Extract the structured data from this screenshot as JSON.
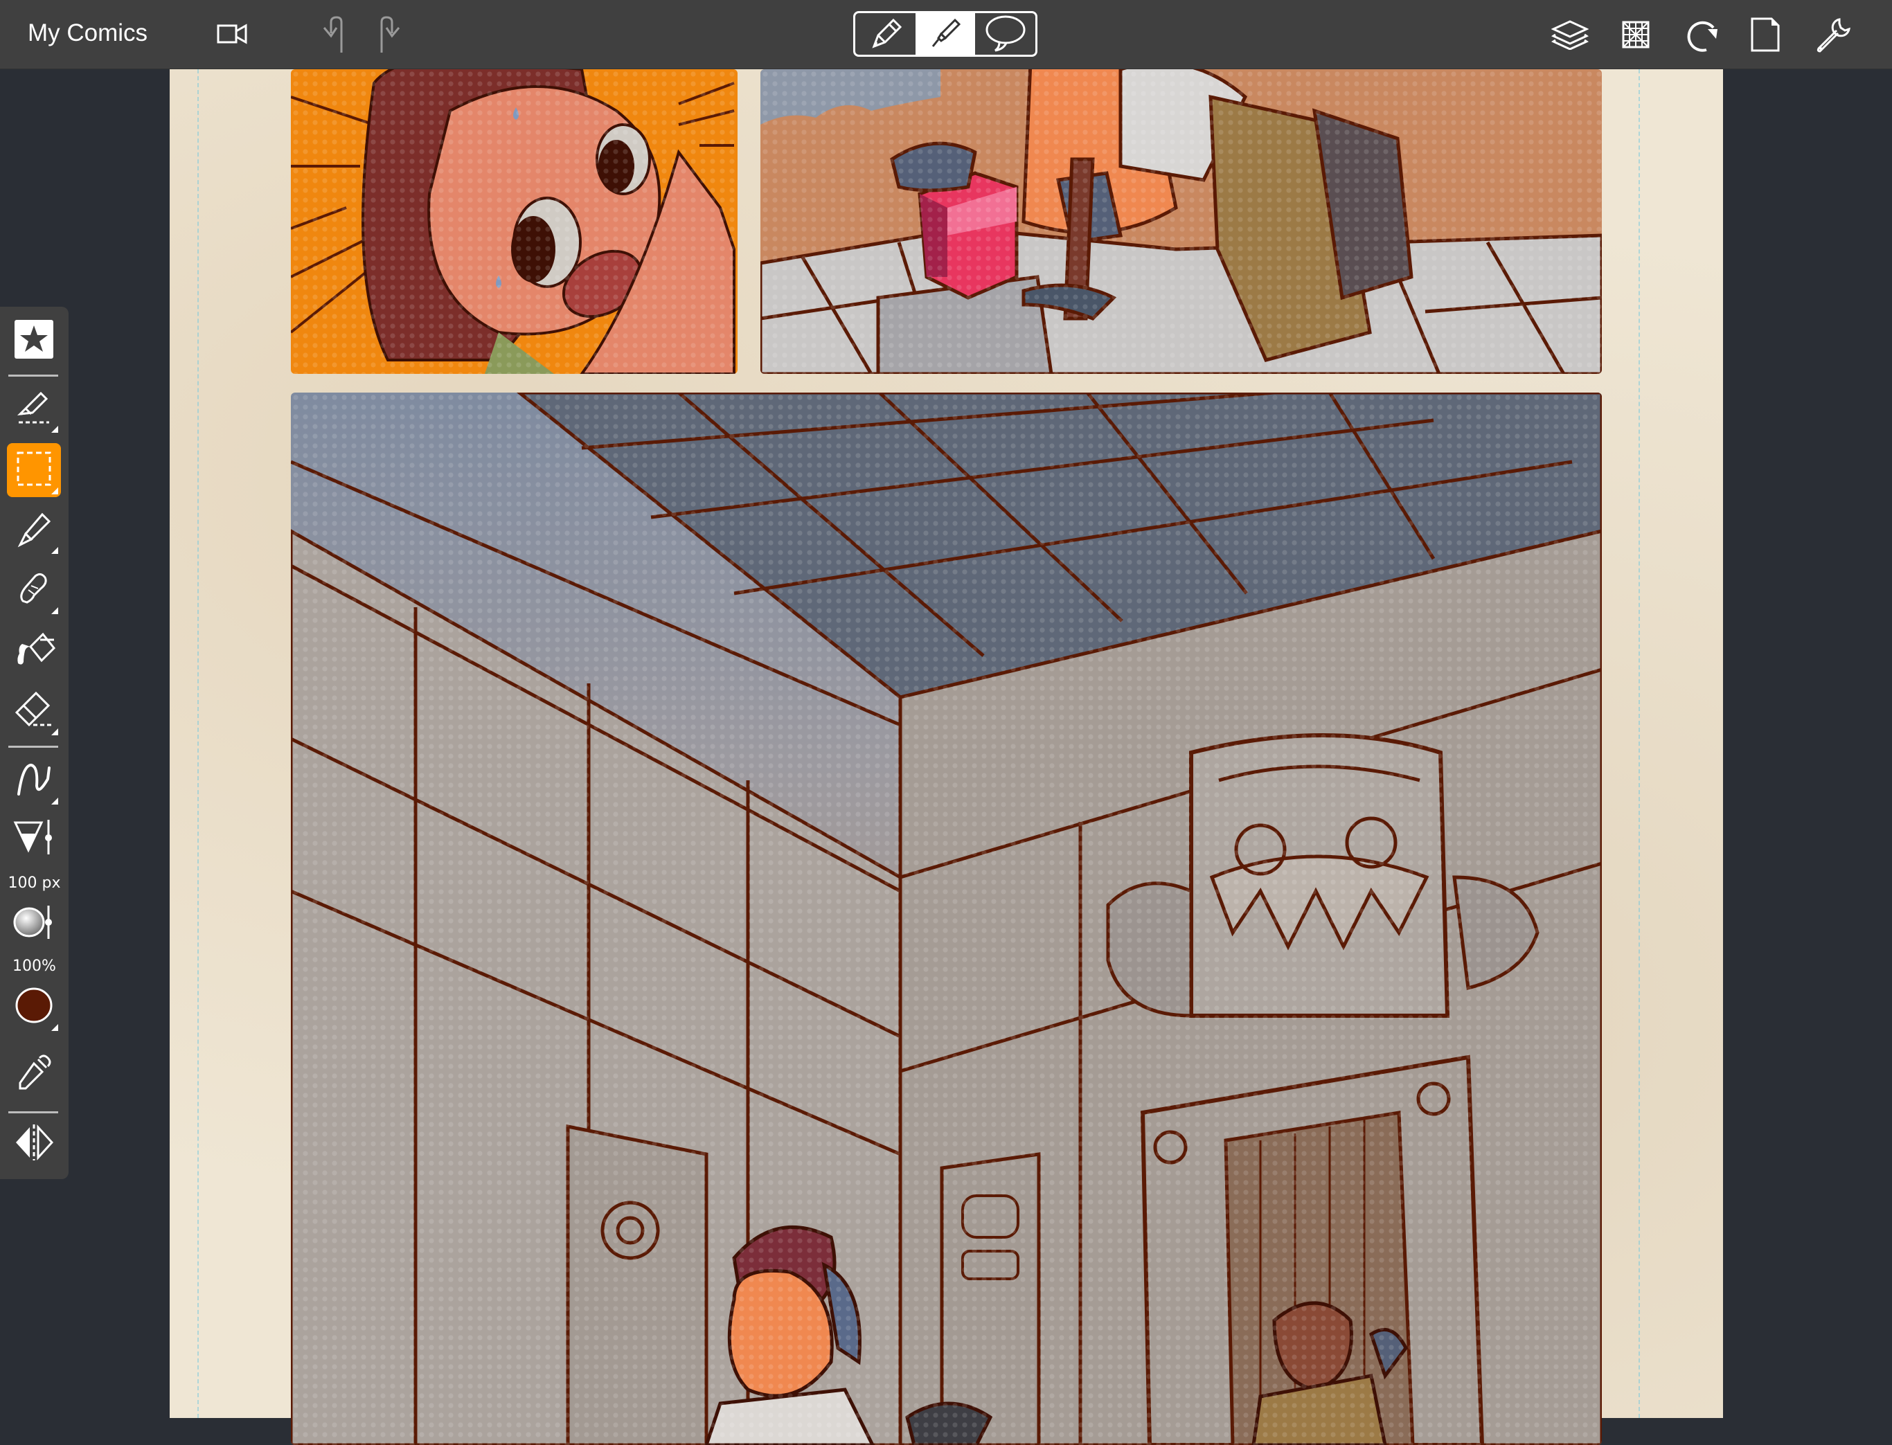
{
  "app": {
    "title": "My Comics"
  },
  "top_bar": {
    "left_icons": [
      {
        "name": "record-video-icon"
      },
      {
        "name": "undo-icon"
      },
      {
        "name": "redo-icon"
      }
    ],
    "mode_switcher": {
      "options": [
        {
          "name": "pencil-mode",
          "icon": "pencil-icon",
          "active": false
        },
        {
          "name": "ink-pen-mode",
          "icon": "ink-pen-icon",
          "active": true
        },
        {
          "name": "speech-bubble-mode",
          "icon": "speech-bubble-icon",
          "active": false
        }
      ]
    },
    "right_icons": [
      {
        "name": "layers-icon"
      },
      {
        "name": "perspective-guide-icon"
      },
      {
        "name": "rotate-canvas-icon"
      },
      {
        "name": "page-icon"
      },
      {
        "name": "settings-wrench-icon"
      }
    ]
  },
  "toolbar": {
    "tools": [
      {
        "name": "favorites",
        "icon": "star-icon",
        "active": false
      },
      {
        "name": "ruler-pen",
        "icon": "ruler-pen-icon",
        "active": false
      },
      {
        "name": "rectangle-selection",
        "icon": "selection-rectangle-icon",
        "active": true
      },
      {
        "name": "pen",
        "icon": "pen-icon",
        "active": false
      },
      {
        "name": "smudge",
        "icon": "smudge-finger-icon",
        "active": false
      },
      {
        "name": "paint-bucket",
        "icon": "paint-bucket-icon",
        "active": false
      },
      {
        "name": "eraser",
        "icon": "eraser-icon",
        "active": false
      },
      {
        "name": "stroke-style",
        "icon": "stroke-curve-icon",
        "active": false
      },
      {
        "name": "brush-size",
        "icon": "brush-size-icon",
        "active": false
      },
      {
        "name": "opacity",
        "icon": "opacity-icon",
        "active": false
      },
      {
        "name": "color",
        "icon": "color-swatch-icon",
        "active": false
      },
      {
        "name": "eyedropper",
        "icon": "eyedropper-icon",
        "active": false
      },
      {
        "name": "flip",
        "icon": "flip-horizontal-icon",
        "active": false
      }
    ],
    "brush_size_label": "100 px",
    "opacity_label": "100%",
    "current_color": "#5a1a05"
  },
  "colors": {
    "accent": "#ff9500",
    "toolbar_bg": "#404040",
    "canvas_bg": "#2a2e35",
    "paper": "#efe6d4",
    "ink": "#5a1a05"
  },
  "canvas": {
    "panels": [
      {
        "name": "panel-girl-closeup",
        "description": "Girl with sweat drops, orange speed-line background"
      },
      {
        "name": "panel-gem-grab",
        "description": "Explorer grabbing a pink gem from a stone pedestal"
      },
      {
        "name": "panel-temple-interior",
        "description": "Low-angle view of a stone temple interior with two explorers"
      }
    ]
  }
}
